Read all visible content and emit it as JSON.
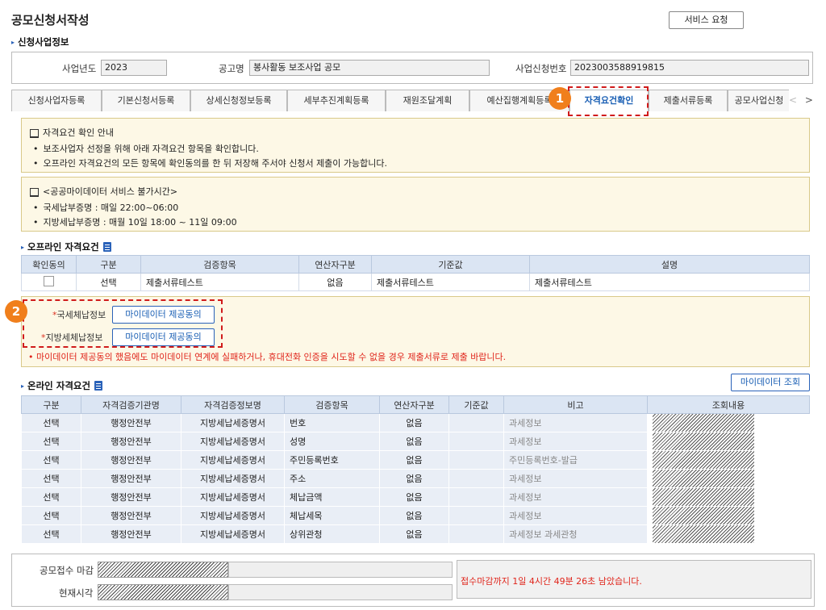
{
  "page": {
    "title": "공모신청서작성",
    "service_request": "서비스 요청"
  },
  "applicant_section": {
    "title": "신청사업정보",
    "fields": [
      {
        "label": "사업년도",
        "value": "2023"
      },
      {
        "label": "공고명",
        "value": "봉사활동 보조사업 공모"
      },
      {
        "label": "사업신청번호",
        "value": "2023003588919815"
      }
    ]
  },
  "tabs": [
    {
      "label": "신청사업자등록",
      "active": false
    },
    {
      "label": "기본신청서등록",
      "active": false
    },
    {
      "label": "상세신청정보등록",
      "active": false
    },
    {
      "label": "세부추진계획등록",
      "active": false
    },
    {
      "label": "재원조달계획",
      "active": false
    },
    {
      "label": "예산집행계획등록",
      "active": false
    },
    {
      "label": "자격요건확인",
      "active": true
    },
    {
      "label": "제출서류등록",
      "active": false
    },
    {
      "label": "공모사업신청",
      "active": false
    }
  ],
  "tab_arrows": {
    "prev": "<",
    "next": ">"
  },
  "badges": {
    "one": "1",
    "two": "2"
  },
  "notice1": {
    "title": "자격요건 확인 안내",
    "items": [
      "보조사업자 선정을 위해 아래 자격요건 항목을 확인합니다.",
      "오프라인 자격요건의 모든 항목에 확인동의를 한 뒤 저장해 주서야 신청서 제출이 가능합니다."
    ]
  },
  "notice2": {
    "title": "<공공마이데이터 서비스 불가시간>",
    "items": [
      "국세납부증명 : 매일 22:00~06:00",
      "지방세납부증명 : 매월 10일 18:00 ~ 11일 09:00"
    ]
  },
  "offline": {
    "title": "오프라인 자격요건",
    "headers": [
      "확인동의",
      "구분",
      "검증항목",
      "연산자구분",
      "기준값",
      "설명"
    ],
    "rows": [
      {
        "type": "선택",
        "item": "제출서류테스트",
        "operator": "없음",
        "standard": "제출서류테스트",
        "desc": "제출서류테스트"
      }
    ]
  },
  "mydata": {
    "national_tax_label": "국세체납정보",
    "local_tax_label": "지방세체납정보",
    "required_mark": "*",
    "consent_button": "마이데이터 제공동의",
    "warning": "• 마이데이터 제공동의 했음에도 마이데이터 연계에 실패하거나, 휴대전화 인증을 시도할 수 없을 경우 제출서류로 제출 바랍니다."
  },
  "online": {
    "title": "온라인 자격요건",
    "query_button": "마이데이터 조회",
    "headers": [
      "구분",
      "자격검증기관명",
      "자격검증정보명",
      "검증항목",
      "연산자구분",
      "기준값",
      "비고",
      "조회내용"
    ],
    "rows": [
      {
        "type": "선택",
        "org": "행정안전부",
        "info": "지방세납세증명서",
        "item": "번호",
        "operator": "없음",
        "standard": "",
        "remark": "과세정보"
      },
      {
        "type": "선택",
        "org": "행정안전부",
        "info": "지방세납세증명서",
        "item": "성명",
        "operator": "없음",
        "standard": "",
        "remark": "과세정보"
      },
      {
        "type": "선택",
        "org": "행정안전부",
        "info": "지방세납세증명서",
        "item": "주민등록번호",
        "operator": "없음",
        "standard": "",
        "remark": "주민등록번호-발급"
      },
      {
        "type": "선택",
        "org": "행정안전부",
        "info": "지방세납세증명서",
        "item": "주소",
        "operator": "없음",
        "standard": "",
        "remark": "과세정보"
      },
      {
        "type": "선택",
        "org": "행정안전부",
        "info": "지방세납세증명서",
        "item": "체납금액",
        "operator": "없음",
        "standard": "",
        "remark": "과세정보"
      },
      {
        "type": "선택",
        "org": "행정안전부",
        "info": "지방세납세증명서",
        "item": "체납세목",
        "operator": "없음",
        "standard": "",
        "remark": "과세정보"
      },
      {
        "type": "선택",
        "org": "행정안전부",
        "info": "지방세납세증명서",
        "item": "상위관청",
        "operator": "없음",
        "standard": "",
        "remark": "과세정보 과세관청"
      }
    ]
  },
  "footer": {
    "deadline_label": "공모접수 마감",
    "current_label": "현재시각",
    "countdown": "접수마감까지 1일 4시간 49분 26초 남았습니다."
  },
  "colors": {
    "accent": "#1a5fb4",
    "badge": "#f07f1c",
    "warn": "#e0251b",
    "dashed": "#d01b1b"
  }
}
